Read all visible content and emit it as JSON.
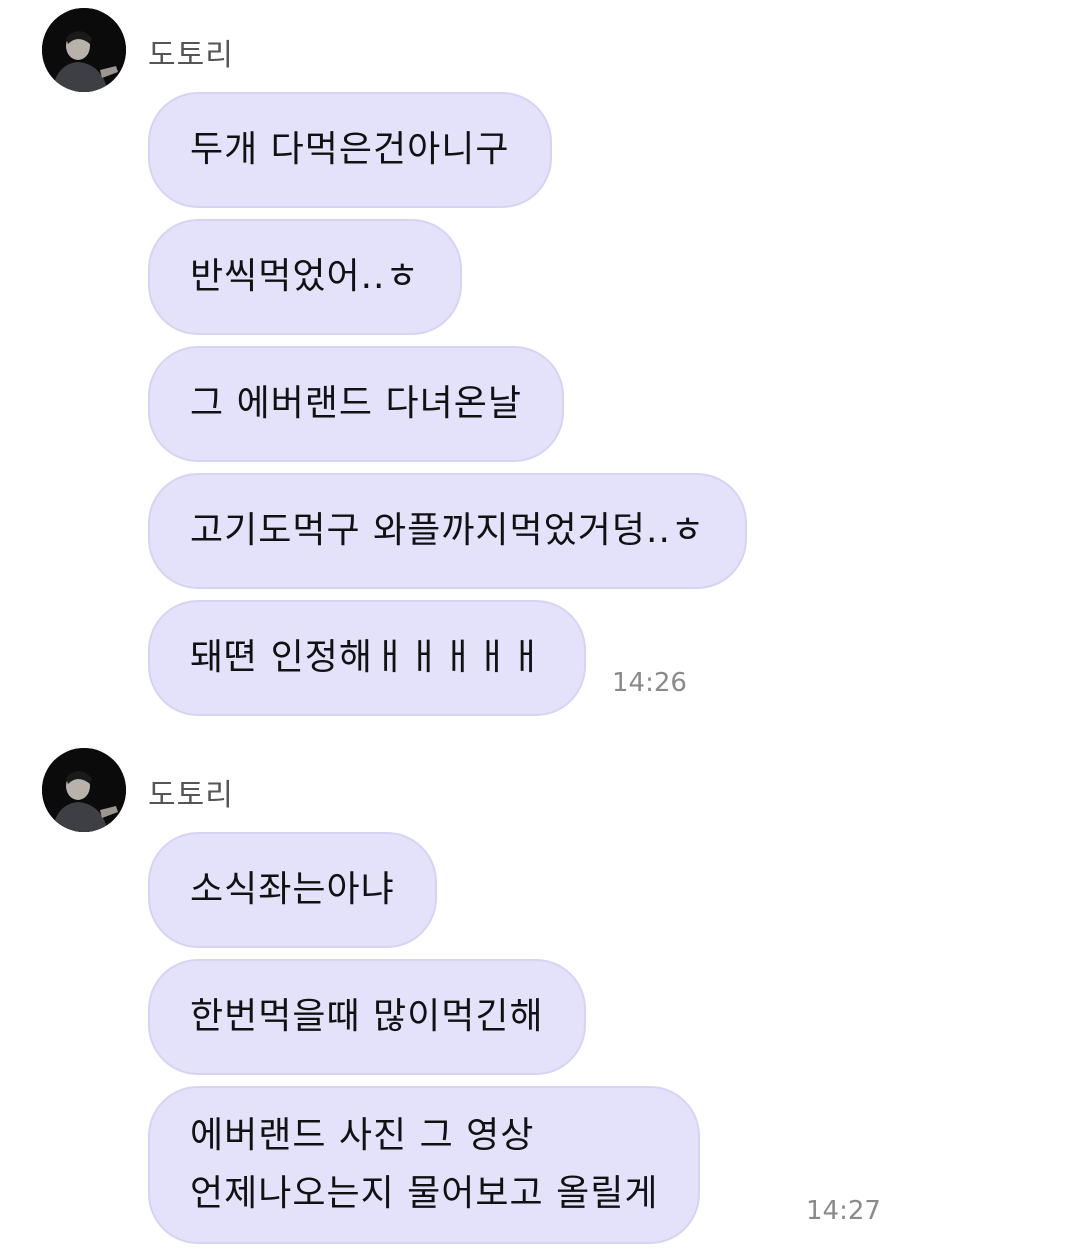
{
  "groups": [
    {
      "sender": "도토리",
      "time": "14:26",
      "messages": [
        {
          "lines": [
            "두개 다먹은건아니구"
          ]
        },
        {
          "lines": [
            "반씩먹었어..ㅎ"
          ]
        },
        {
          "lines": [
            "그 에버랜드 다녀온날"
          ]
        },
        {
          "lines": [
            "고기도먹구 와플까지먹었거덩..ㅎ"
          ]
        },
        {
          "lines": [
            "돼뗜 인정해ㅐㅐㅐㅐㅐ"
          ]
        }
      ]
    },
    {
      "sender": "도토리",
      "time": "14:27",
      "messages": [
        {
          "lines": [
            "소식좌는아냐"
          ]
        },
        {
          "lines": [
            "한번먹을때 많이먹긴해"
          ]
        },
        {
          "lines": [
            "에버랜드 사진 그 영상",
            "언제나오는지 물어보고 올릴게"
          ]
        }
      ]
    }
  ],
  "icons": {
    "avatar": "profile-photo-icon"
  },
  "colors": {
    "bubble": "#e4e1fa",
    "bubble_border": "#d8d3f3",
    "sender_text": "#555555",
    "time_text": "#8a8a8a"
  }
}
